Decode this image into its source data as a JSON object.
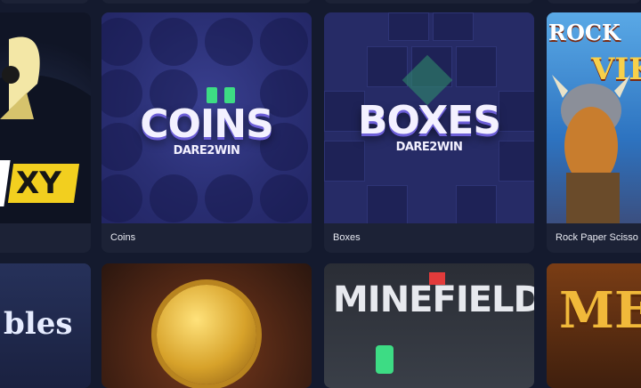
{
  "games": [
    {
      "id": "hexy",
      "label": "",
      "art_text": "EXY"
    },
    {
      "id": "coins",
      "label": "Coins",
      "art_title": "COINS",
      "art_sub": "DARE2WIN"
    },
    {
      "id": "boxes",
      "label": "Boxes",
      "art_title": "BOXES",
      "art_sub": "DARE2WIN"
    },
    {
      "id": "rps",
      "label": "Rock Paper Scisso",
      "art_title": "ROCK",
      "art_title2": "VIK"
    }
  ],
  "games_row2": [
    {
      "id": "bubbles",
      "art_text": "bles"
    },
    {
      "id": "gold-coin",
      "art_text": ""
    },
    {
      "id": "minefield",
      "art_text": "MINEFIELD"
    },
    {
      "id": "mega",
      "art_text": "ME"
    }
  ],
  "colors": {
    "background": "#141a2e",
    "card": "#1c2236",
    "accent_green": "#3ddc84",
    "label_text": "#e8eaf2"
  }
}
